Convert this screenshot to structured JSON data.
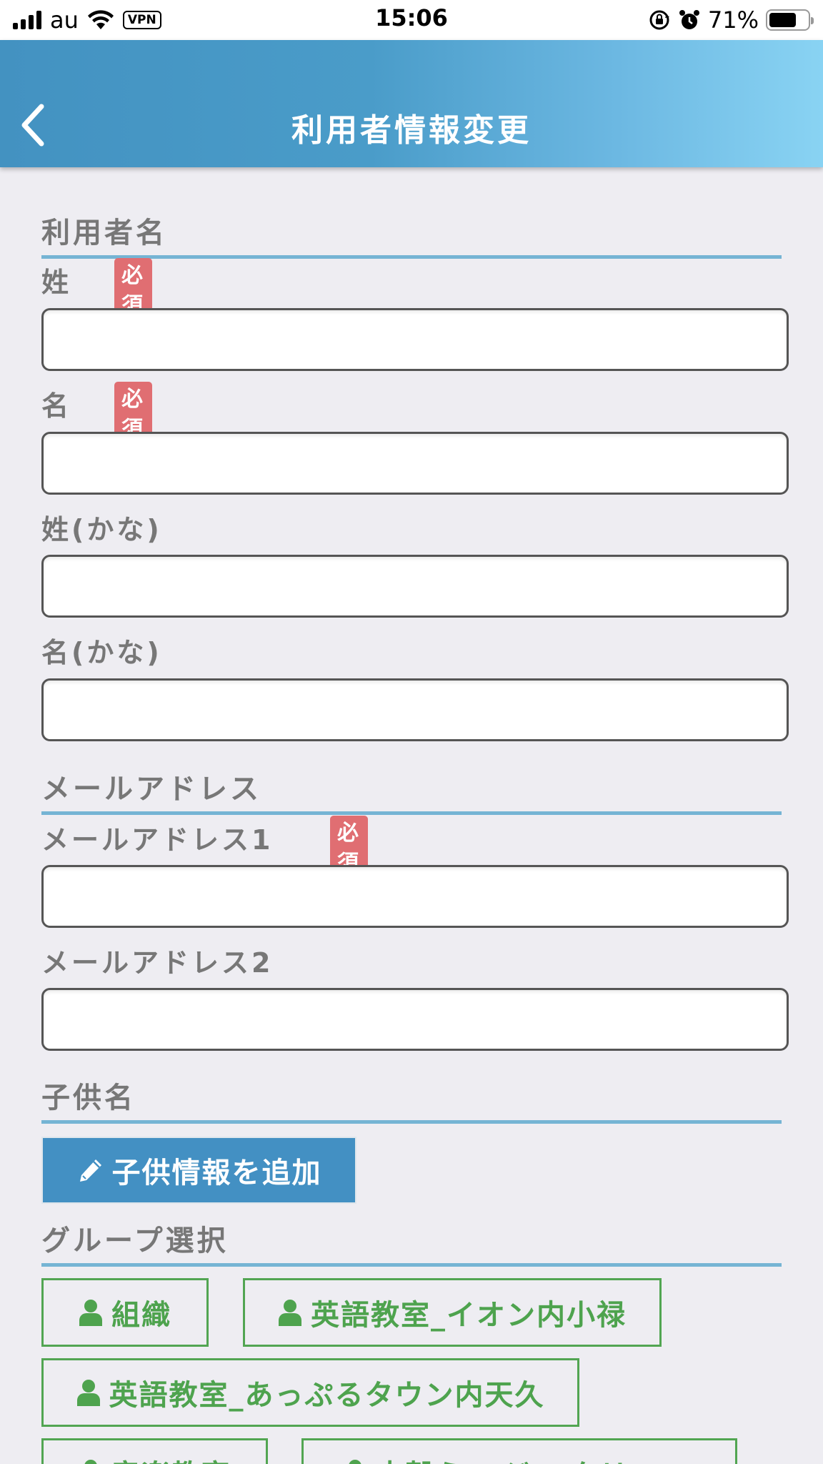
{
  "status_bar": {
    "carrier": "au",
    "vpn": "VPN",
    "time": "15:06",
    "battery_percent": "71%",
    "battery_level": 0.71
  },
  "nav": {
    "title": "利用者情報変更",
    "back_icon": "chevron-left-icon"
  },
  "sections": {
    "user_name": {
      "title": "利用者名",
      "last_name_label": "姓",
      "first_name_label": "名",
      "last_name_kana_label": "姓(かな)",
      "first_name_kana_label": "名(かな)",
      "required_badge": "必須"
    },
    "email": {
      "title": "メールアドレス",
      "email1_label": "メールアドレス1",
      "email2_label": "メールアドレス2",
      "required_badge": "必須"
    },
    "children": {
      "title": "子供名",
      "add_button_label": "子供情報を追加",
      "add_button_icon": "pencil-icon"
    },
    "groups": {
      "title": "グループ選択",
      "items": [
        {
          "label": "組織",
          "icon": "user-icon"
        },
        {
          "label": "英語教室_イオン内小禄",
          "icon": "user-icon"
        },
        {
          "label": "英語教室_あっぷるタウン内天久",
          "icon": "user-icon"
        },
        {
          "label": "音楽教室",
          "icon": "user-icon"
        },
        {
          "label": "大穀ら...ジ...クリエ...",
          "icon": "user-icon"
        }
      ]
    }
  },
  "colors": {
    "nav_gradient_start": "#4392c1",
    "nav_gradient_end": "#89d3f3",
    "section_underline": "#75b4d4",
    "required_badge": "#e06e72",
    "primary_button": "#4390c3",
    "group_green": "#4ea34e",
    "background": "#eeedf2"
  }
}
